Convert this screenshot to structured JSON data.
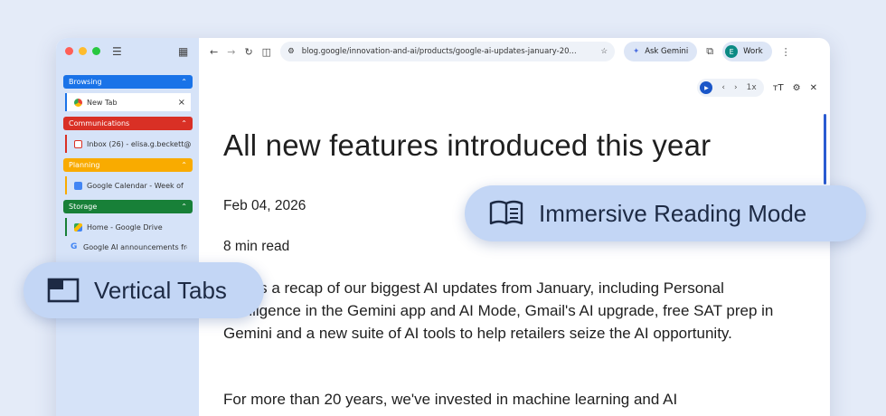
{
  "sidebar": {
    "groups": [
      {
        "label": "Browsing",
        "color": "#1a73e8",
        "tabs": [
          {
            "title": "New Tab",
            "icon": "chrome-icon",
            "closable": true
          }
        ]
      },
      {
        "label": "Communications",
        "color": "#d93025",
        "tabs": [
          {
            "title": "Inbox (26) - elisa.g.beckett@",
            "icon": "gmail-icon"
          }
        ]
      },
      {
        "label": "Planning",
        "color": "#f9ab00",
        "tabs": [
          {
            "title": "Google Calendar - Week of",
            "icon": "calendar-icon"
          }
        ]
      },
      {
        "label": "Storage",
        "color": "#188038",
        "tabs": [
          {
            "title": "Home - Google Drive",
            "icon": "drive-icon"
          }
        ]
      }
    ],
    "ungrouped": [
      {
        "title": "Google AI announcements fro",
        "icon": "google-icon"
      }
    ]
  },
  "toolbar": {
    "url": "blog.google/innovation-and-ai/products/google-ai-updates-january-20...",
    "ask_gemini": "Ask Gemini",
    "profile_initial": "E",
    "profile_label": "Work"
  },
  "reader": {
    "speed": "1x",
    "text_size_label": "ᴛT"
  },
  "article": {
    "title": "All new features introduced this year",
    "date": "Feb 04, 2026",
    "read_time": "8 min read",
    "p1": "Here's a recap of our biggest AI updates from January, including Personal Intelligence in the Gemini app and AI Mode, Gmail's AI upgrade, free SAT prep in Gemini and a new suite of AI tools to help retailers seize the AI opportunity.",
    "p2": "For more than 20 years, we've invested in machine learning and AI"
  },
  "callouts": {
    "reading": "Immersive Reading Mode",
    "tabs": "Vertical Tabs"
  }
}
